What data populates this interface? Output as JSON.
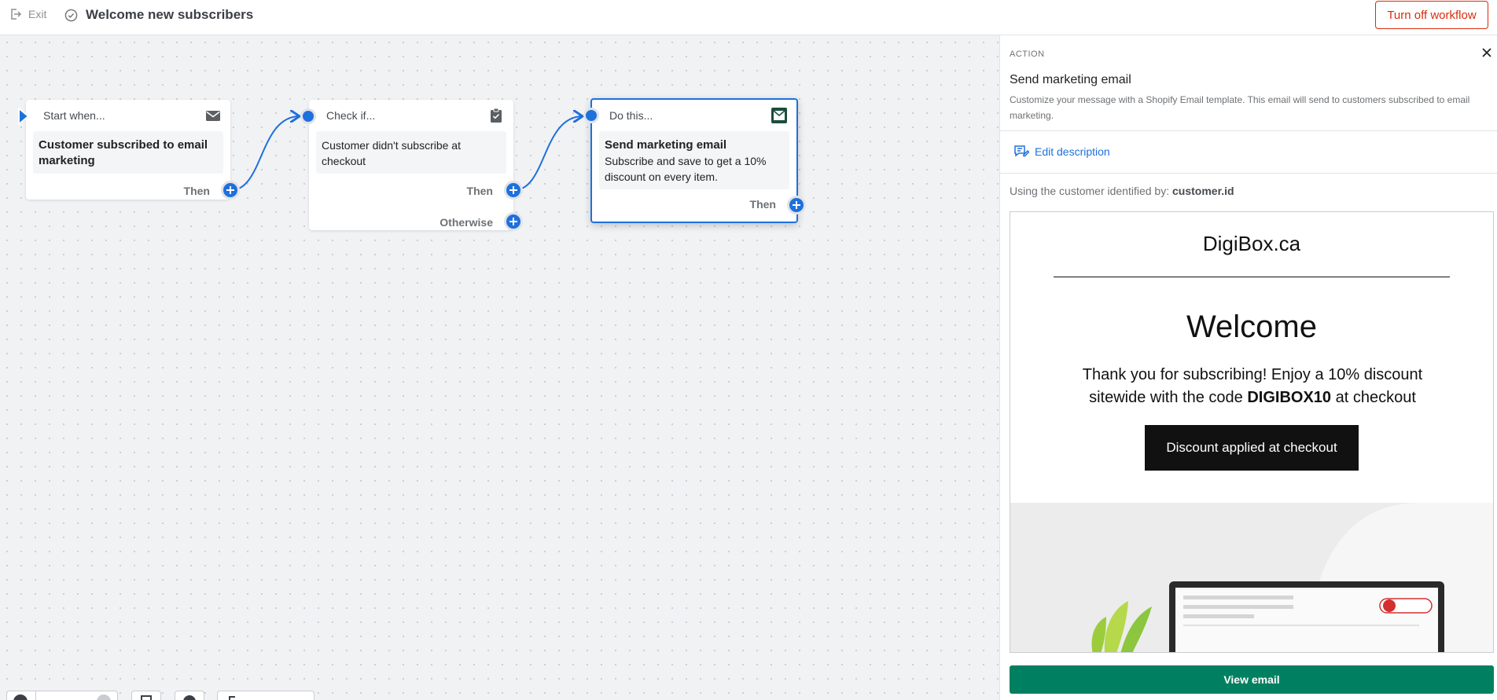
{
  "header": {
    "exit_label": "Exit",
    "workflow_title": "Welcome new subscribers",
    "turn_off_label": "Turn off workflow"
  },
  "nodes": [
    {
      "head": "Start when...",
      "body": "Customer subscribed to email marketing",
      "then_label": "Then",
      "icon": "envelope-icon"
    },
    {
      "head": "Check if...",
      "body": "Customer didn't subscribe at checkout",
      "then_label": "Then",
      "otherwise_label": "Otherwise",
      "icon": "clipboard-check-icon"
    },
    {
      "head": "Do this...",
      "title": "Send marketing email",
      "body": "Subscribe and save to get a 10% discount on every item.",
      "then_label": "Then",
      "icon": "email-app-icon"
    }
  ],
  "panel": {
    "section": "ACTION",
    "title": "Send marketing email",
    "description": "Customize your message with a Shopify Email template. This email will send to customers subscribed to email marketing.",
    "edit_description": "Edit description",
    "using_prefix": "Using the customer identified by:",
    "using_value": "customer.id",
    "preview": {
      "brand": "DigiBox.ca",
      "heading": "Welcome",
      "text_before": "Thank you for subscribing! Enjoy a 10% discount sitewide with the code ",
      "code": "DIGIBOX10",
      "text_after": " at checkout",
      "button": "Discount applied at checkout"
    },
    "view_email": "View email"
  },
  "colors": {
    "accent": "#1f70dc",
    "danger": "#d82c0d",
    "primary_green": "#008060"
  }
}
